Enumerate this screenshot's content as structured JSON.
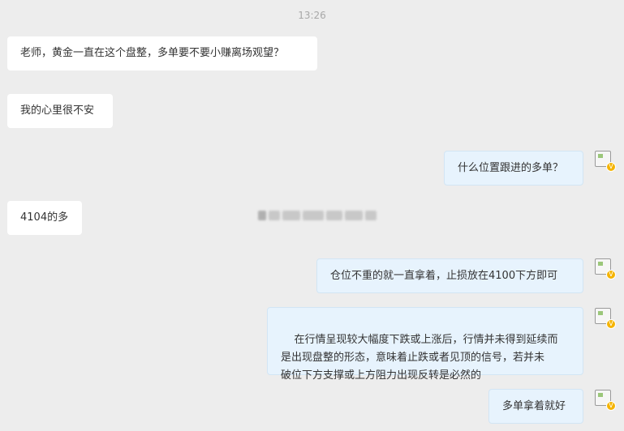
{
  "chat": {
    "timestamp": "13:26",
    "messages": [
      {
        "side": "left",
        "text": "老师，黄金一直在这个盘整，多单要不要小赚离场观望？"
      },
      {
        "side": "left",
        "text": "我的心里很不安"
      },
      {
        "side": "right",
        "text": "什么位置跟进的多单？"
      },
      {
        "side": "left",
        "text": "4104的多"
      },
      {
        "side": "right",
        "text": "仓位不重的就一直拿着，止损放在4100下方即可"
      },
      {
        "side": "right",
        "text": "在行情呈现较大幅度下跌或上涨后，行情并未得到延续而\n是出现盘整的形态，意味着止跌或者见顶的信号，若并未\n破位下方支撑或上方阻力出现反转是必然的"
      },
      {
        "side": "right",
        "text": "多单拿着就好"
      }
    ],
    "avatar_badge": "V"
  },
  "icons": {
    "avatar": "broken-image-avatar-icon",
    "badge": "verified-v-badge-icon"
  },
  "colors": {
    "background": "#ededed",
    "left_bubble": "#ffffff",
    "right_bubble": "#e7f3fd",
    "badge": "#f5b400"
  }
}
